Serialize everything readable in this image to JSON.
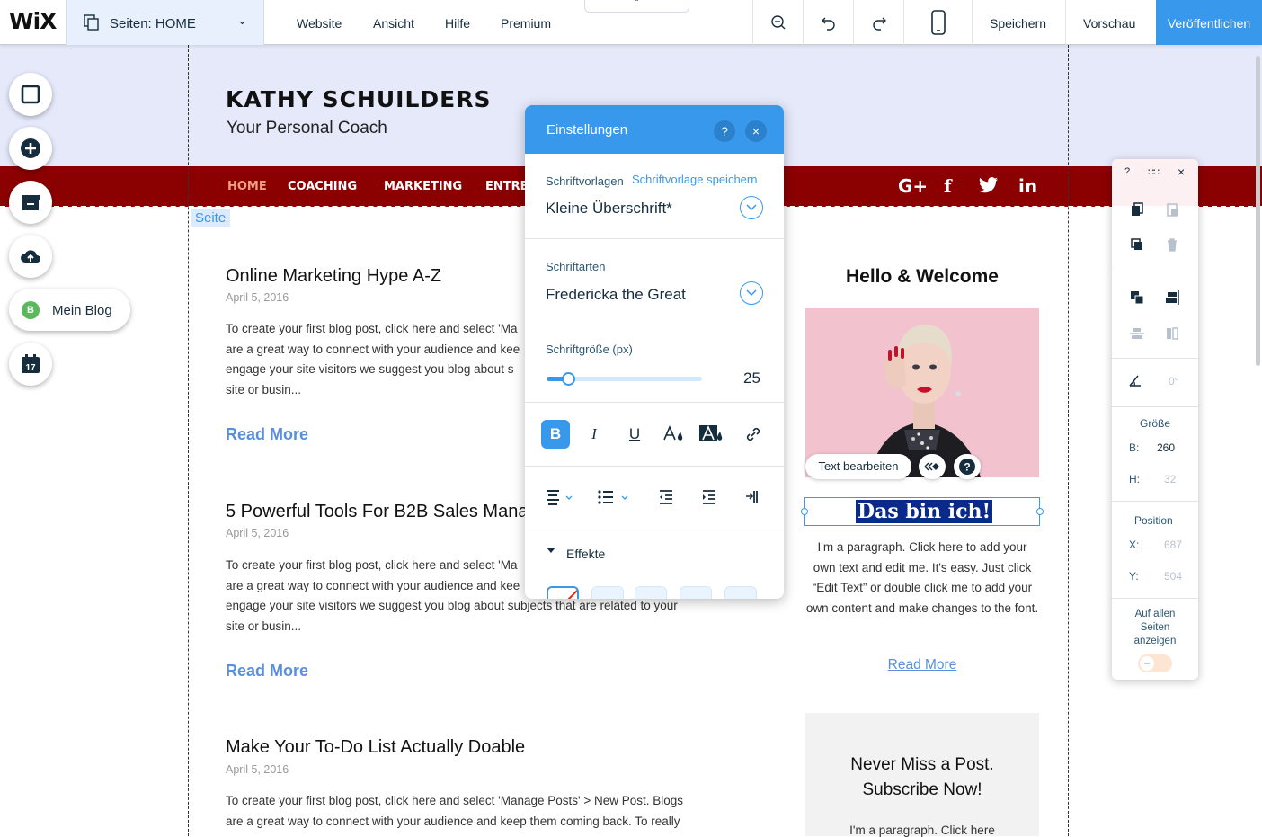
{
  "topbar": {
    "logo": "WiX",
    "pages_label": "Seiten: HOME",
    "menu": [
      "Website",
      "Ansicht",
      "Hilfe",
      "Premium"
    ],
    "save": "Speichern",
    "preview": "Vorschau",
    "publish": "Veröffentlichen",
    "icons": [
      "zoom-out-icon",
      "undo-icon",
      "redo-icon",
      "mobile-view-icon"
    ]
  },
  "site": {
    "name": "KATHY SCHUILDERS",
    "tagline": "Your Personal Coach",
    "nav": [
      "HOME",
      "COACHING",
      "MARKETING",
      "ENTRE"
    ],
    "social": [
      "G+",
      "f",
      "twitter",
      "in"
    ],
    "page_tag": "Seite",
    "posts": [
      {
        "title": "Online Marketing Hype A-Z",
        "date": "April 5, 2016",
        "lines": [
          "To create your first blog post, click here and select 'Ma",
          "are a great way to connect with your audience and kee",
          "engage your site visitors we suggest you blog about s",
          "site or busin..."
        ],
        "read_more": "Read More"
      },
      {
        "title": "5 Powerful Tools For B2B Sales Mana",
        "date": "April 5, 2016",
        "lines": [
          "To create your first blog post, click here and select 'Ma",
          "are a great way to connect with your audience and kee",
          "engage your site visitors we suggest you blog about subjects that are related to your",
          "site or busin..."
        ],
        "read_more": "Read More"
      },
      {
        "title": "Make Your To-Do List Actually Doable",
        "date": "April 5, 2016",
        "lines": [
          "To create your first blog post, click here and select 'Manage Posts' > New Post. Blogs",
          "are a great way to connect with your audience and keep them coming back. To really"
        ]
      }
    ],
    "welcome": "Hello & Welcome",
    "edit_text": "Text bearbeiten",
    "headline": "Das bin ich!",
    "paragraph": "I'm a paragraph. Click here to add your own text and edit me. It's easy. Just click “Edit Text” or double click me to add your own content and make changes to the font.",
    "read_more_right": "Read More",
    "subscribe_title_1": "Never Miss a Post.",
    "subscribe_title_2": "Subscribe Now!",
    "subscribe_para": "I'm a paragraph. Click here"
  },
  "left_tools": {
    "blog_badge": "B",
    "blog_label": "Mein Blog",
    "calendar_day": "17",
    "icons": [
      "background-icon",
      "add-icon",
      "app-market-icon",
      "upload-icon",
      "calendar-icon"
    ]
  },
  "settings": {
    "title": "Einstellungen",
    "help": "?",
    "close": "×",
    "templates_label": "Schriftvorlagen",
    "templates_save": "Schriftvorlage speichern",
    "template_value": "Kleine Überschrift*",
    "fonts_label": "Schriftarten",
    "font_value": "Fredericka the Great",
    "size_label": "Schriftgröße (px)",
    "size_value": "25",
    "size_fraction": 0.14,
    "effects_label": "Effekte"
  },
  "inspector": {
    "help": "?",
    "close": "×",
    "angle": "0°",
    "size_label": "Größe",
    "w_label": "B:",
    "w_value": "260",
    "h_label": "H:",
    "h_value": "32",
    "pos_label": "Position",
    "x_label": "X:",
    "x_value": "687",
    "y_label": "Y:",
    "y_value": "504",
    "show_all_1": "Auf allen",
    "show_all_2": "Seiten",
    "show_all_3": "anzeigen",
    "toggle_symbol": "–"
  },
  "colors": {
    "accent": "#3899ec",
    "nav_bg": "#8b0101",
    "header_bg": "#e5e9fa",
    "nav_active": "#ef9f85"
  }
}
